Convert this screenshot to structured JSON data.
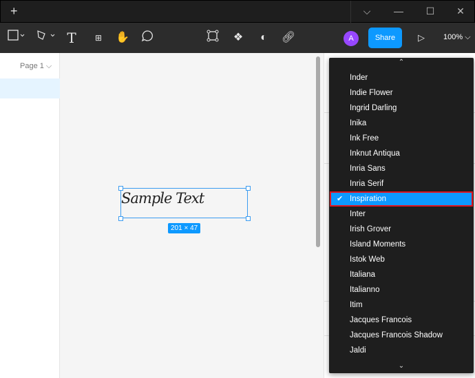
{
  "titlebar": {
    "new_tab": "+",
    "chevron": "⌵",
    "minimize": "—",
    "maximize": "☐",
    "close": "✕"
  },
  "toolbar": {
    "share_label": "Share",
    "avatar_initial": "A",
    "zoom_level": "100%"
  },
  "pages": {
    "current": "Page 1"
  },
  "canvas": {
    "text": "Sample Text",
    "dimensions": "201 × 47"
  },
  "font_dropdown": {
    "selected": "Inspiration",
    "items": [
      "Inder",
      "Indie Flower",
      "Ingrid Darling",
      "Inika",
      "Ink Free",
      "Inknut Antiqua",
      "Inria Sans",
      "Inria Serif",
      "Inspiration",
      "Inter",
      "Irish Grover",
      "Island Moments",
      "Istok Web",
      "Italiana",
      "Italianno",
      "Itim",
      "Jacques Francois",
      "Jacques Francois Shadow",
      "Jaldi"
    ]
  },
  "colors": {
    "accent": "#0d99ff",
    "highlight": "#e0141e",
    "avatar": "#9747ff"
  }
}
